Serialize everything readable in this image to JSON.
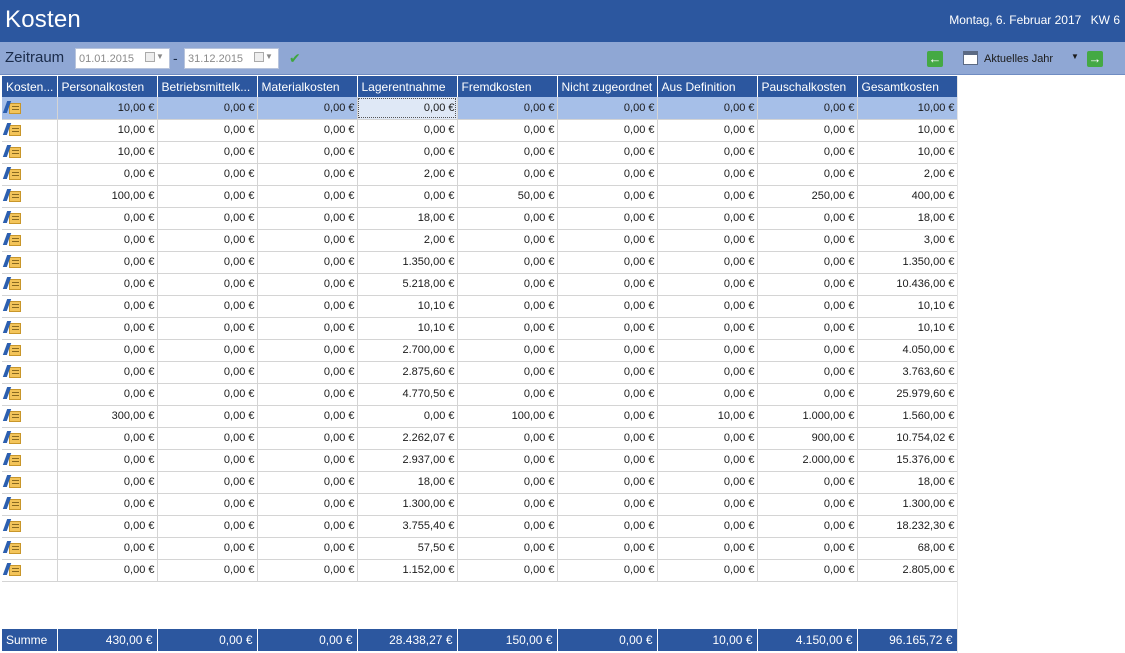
{
  "window": {
    "title": "Kosten",
    "date": "Montag, 6. Februar 2017",
    "week": "KW 6"
  },
  "toolbar": {
    "period_label": "Zeitraum",
    "from_date": "01.01.2015",
    "to_date": "31.12.2015",
    "separator": "-",
    "period_preset": "Aktuelles Jahr"
  },
  "table": {
    "columns": [
      "Kosten...",
      "Personalkosten",
      "Betriebsmittelk...",
      "Materialkosten",
      "Lagerentnahme",
      "Fremdkosten",
      "Nicht zugeordnet",
      "Aus Definition",
      "Pauschalkosten",
      "Gesamtkosten"
    ],
    "rows": [
      [
        "10,00 €",
        "0,00 €",
        "0,00 €",
        "0,00 €",
        "0,00 €",
        "0,00 €",
        "0,00 €",
        "0,00 €",
        "10,00 €"
      ],
      [
        "10,00 €",
        "0,00 €",
        "0,00 €",
        "0,00 €",
        "0,00 €",
        "0,00 €",
        "0,00 €",
        "0,00 €",
        "10,00 €"
      ],
      [
        "10,00 €",
        "0,00 €",
        "0,00 €",
        "0,00 €",
        "0,00 €",
        "0,00 €",
        "0,00 €",
        "0,00 €",
        "10,00 €"
      ],
      [
        "0,00 €",
        "0,00 €",
        "0,00 €",
        "2,00 €",
        "0,00 €",
        "0,00 €",
        "0,00 €",
        "0,00 €",
        "2,00 €"
      ],
      [
        "100,00 €",
        "0,00 €",
        "0,00 €",
        "0,00 €",
        "50,00 €",
        "0,00 €",
        "0,00 €",
        "250,00 €",
        "400,00 €"
      ],
      [
        "0,00 €",
        "0,00 €",
        "0,00 €",
        "18,00 €",
        "0,00 €",
        "0,00 €",
        "0,00 €",
        "0,00 €",
        "18,00 €"
      ],
      [
        "0,00 €",
        "0,00 €",
        "0,00 €",
        "2,00 €",
        "0,00 €",
        "0,00 €",
        "0,00 €",
        "0,00 €",
        "3,00 €"
      ],
      [
        "0,00 €",
        "0,00 €",
        "0,00 €",
        "1.350,00 €",
        "0,00 €",
        "0,00 €",
        "0,00 €",
        "0,00 €",
        "1.350,00 €"
      ],
      [
        "0,00 €",
        "0,00 €",
        "0,00 €",
        "5.218,00 €",
        "0,00 €",
        "0,00 €",
        "0,00 €",
        "0,00 €",
        "10.436,00 €"
      ],
      [
        "0,00 €",
        "0,00 €",
        "0,00 €",
        "10,10 €",
        "0,00 €",
        "0,00 €",
        "0,00 €",
        "0,00 €",
        "10,10 €"
      ],
      [
        "0,00 €",
        "0,00 €",
        "0,00 €",
        "10,10 €",
        "0,00 €",
        "0,00 €",
        "0,00 €",
        "0,00 €",
        "10,10 €"
      ],
      [
        "0,00 €",
        "0,00 €",
        "0,00 €",
        "2.700,00 €",
        "0,00 €",
        "0,00 €",
        "0,00 €",
        "0,00 €",
        "4.050,00 €"
      ],
      [
        "0,00 €",
        "0,00 €",
        "0,00 €",
        "2.875,60 €",
        "0,00 €",
        "0,00 €",
        "0,00 €",
        "0,00 €",
        "3.763,60 €"
      ],
      [
        "0,00 €",
        "0,00 €",
        "0,00 €",
        "4.770,50 €",
        "0,00 €",
        "0,00 €",
        "0,00 €",
        "0,00 €",
        "25.979,60 €"
      ],
      [
        "300,00 €",
        "0,00 €",
        "0,00 €",
        "0,00 €",
        "100,00 €",
        "0,00 €",
        "10,00 €",
        "1.000,00 €",
        "1.560,00 €"
      ],
      [
        "0,00 €",
        "0,00 €",
        "0,00 €",
        "2.262,07 €",
        "0,00 €",
        "0,00 €",
        "0,00 €",
        "900,00 €",
        "10.754,02 €"
      ],
      [
        "0,00 €",
        "0,00 €",
        "0,00 €",
        "2.937,00 €",
        "0,00 €",
        "0,00 €",
        "0,00 €",
        "2.000,00 €",
        "15.376,00 €"
      ],
      [
        "0,00 €",
        "0,00 €",
        "0,00 €",
        "18,00 €",
        "0,00 €",
        "0,00 €",
        "0,00 €",
        "0,00 €",
        "18,00 €"
      ],
      [
        "0,00 €",
        "0,00 €",
        "0,00 €",
        "1.300,00 €",
        "0,00 €",
        "0,00 €",
        "0,00 €",
        "0,00 €",
        "1.300,00 €"
      ],
      [
        "0,00 €",
        "0,00 €",
        "0,00 €",
        "3.755,40 €",
        "0,00 €",
        "0,00 €",
        "0,00 €",
        "0,00 €",
        "18.232,30 €"
      ],
      [
        "0,00 €",
        "0,00 €",
        "0,00 €",
        "57,50 €",
        "0,00 €",
        "0,00 €",
        "0,00 €",
        "0,00 €",
        "68,00 €"
      ],
      [
        "0,00 €",
        "0,00 €",
        "0,00 €",
        "1.152,00 €",
        "0,00 €",
        "0,00 €",
        "0,00 €",
        "0,00 €",
        "2.805,00 €"
      ]
    ],
    "selected_row": 0,
    "row_icon": "edit-document-icon"
  },
  "footer": {
    "label": "Summe",
    "values": [
      "430,00 €",
      "0,00 €",
      "0,00 €",
      "28.438,27 €",
      "150,00 €",
      "0,00 €",
      "10,00 €",
      "4.150,00 €",
      "96.165,72 €"
    ]
  },
  "colors": {
    "header_bg": "#2c579f",
    "toolbar_bg": "#8fa7d4",
    "selected_row": "#a6bfe8",
    "nav_green": "#44a944"
  }
}
